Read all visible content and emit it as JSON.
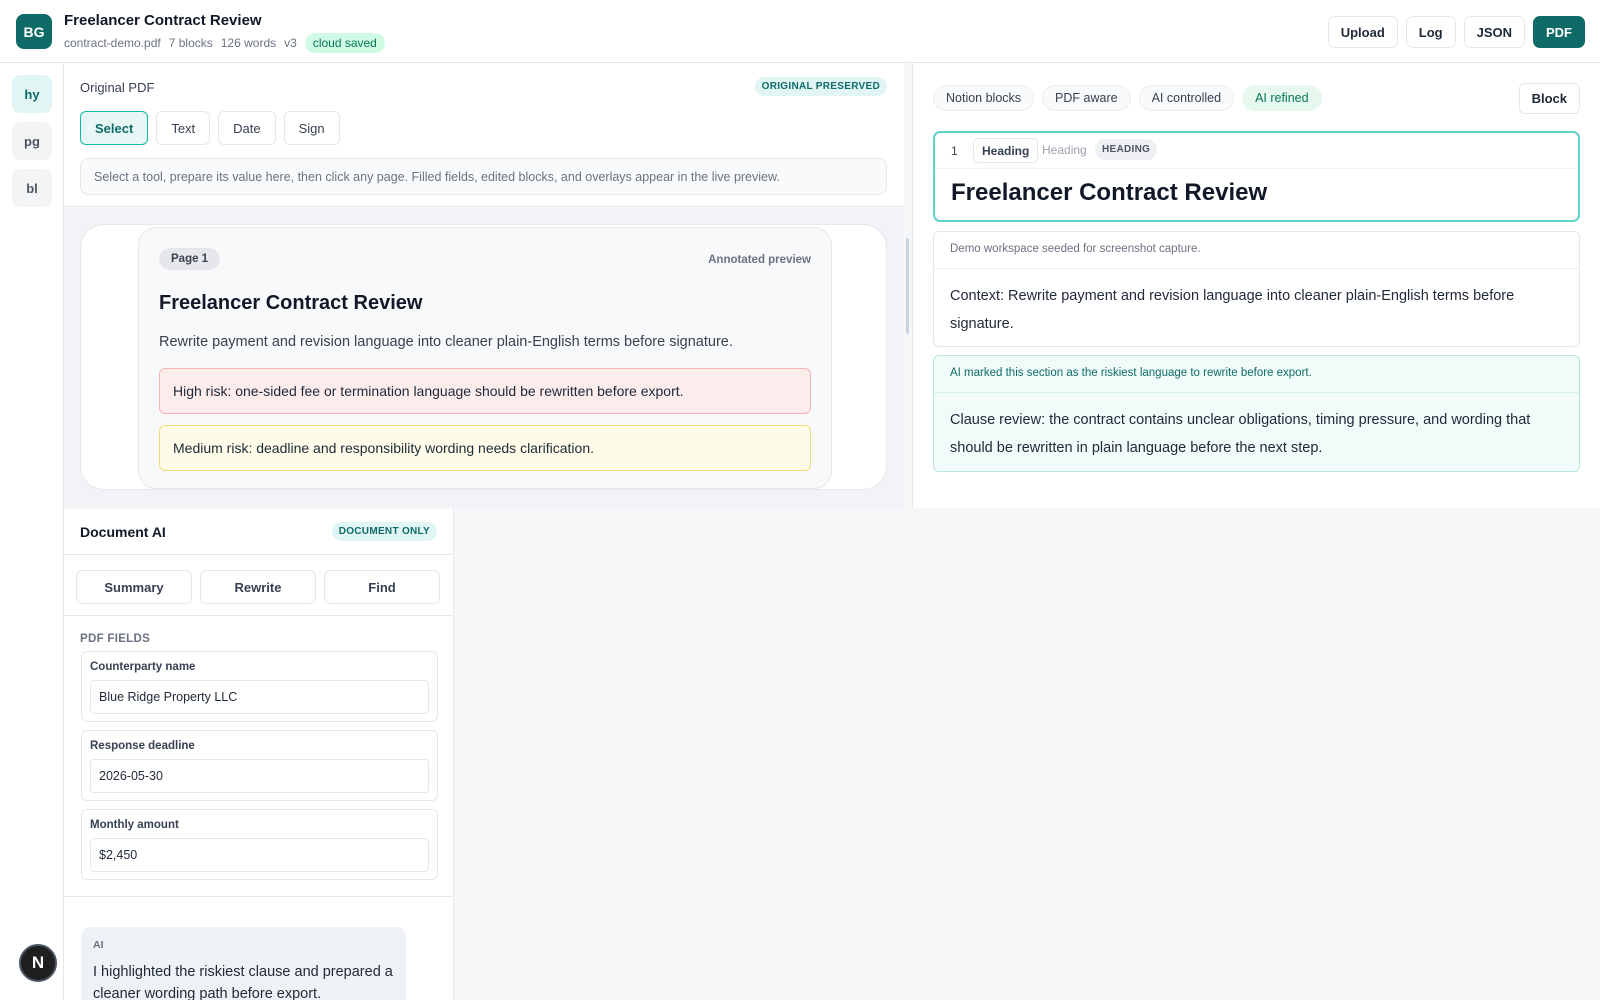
{
  "header": {
    "logo": "BG",
    "title": "Freelancer Contract Review",
    "file": "contract-demo.pdf",
    "blocks": "7 blocks",
    "words": "126 words",
    "version": "v3",
    "status": "cloud saved",
    "actions": {
      "upload": "Upload",
      "log": "Log",
      "json": "JSON",
      "pdf": "PDF"
    }
  },
  "rail": {
    "items": [
      {
        "label": "hy",
        "active": true
      },
      {
        "label": "pg",
        "active": false
      },
      {
        "label": "bl",
        "active": false
      }
    ],
    "bottom_badge": "N"
  },
  "original": {
    "title": "Original PDF",
    "badge": "ORIGINAL PRESERVED",
    "tools": [
      "Select",
      "Text",
      "Date",
      "Sign"
    ],
    "active_tool": "Select",
    "hint": "Select a tool, prepare its value here, then click any page. Filled fields, edited blocks, and overlays appear in the live preview.",
    "page": {
      "label": "Page 1",
      "mode": "Annotated preview",
      "heading": "Freelancer Contract Review",
      "paragraph": "Rewrite payment and revision language into cleaner plain-English terms before signature.",
      "high_risk": "High risk: one-sided fee or termination language should be rewritten before export.",
      "medium_risk": "Medium risk: deadline and responsibility wording needs clarification."
    }
  },
  "blocks_panel": {
    "chips": [
      "Notion blocks",
      "PDF aware",
      "AI controlled",
      "AI refined"
    ],
    "block_button": "Block",
    "block1": {
      "number": "1",
      "type_select": "Heading",
      "type_label": "Heading",
      "tag": "HEADING",
      "text": "Freelancer Contract Review"
    },
    "block2": {
      "note": "Demo workspace seeded for screenshot capture.",
      "text": "Context: Rewrite payment and revision language into cleaner plain-English terms before signature."
    },
    "block3": {
      "note": "AI marked this section as the riskiest language to rewrite before export.",
      "text": "Clause review: the contract contains unclear obligations, timing pressure, and wording that should be rewritten in plain language before the next step."
    }
  },
  "ai": {
    "title": "Document AI",
    "badge": "DOCUMENT ONLY",
    "tabs": [
      "Summary",
      "Rewrite",
      "Find"
    ],
    "fields_title": "PDF FIELDS",
    "fields": [
      {
        "label": "Counterparty name",
        "value": "Blue Ridge Property LLC"
      },
      {
        "label": "Response deadline",
        "value": "2026-05-30"
      },
      {
        "label": "Monthly amount",
        "value": "$2,450"
      }
    ],
    "message": {
      "who": "AI",
      "text": "I highlighted the riskiest clause and prepared a cleaner wording path before export."
    }
  },
  "colors": {
    "brand": "#0f6b68",
    "accent_border": "#5fd3c8",
    "high_risk_bg": "#fdecec",
    "medium_risk_bg": "#fefce8",
    "saved_green": "#047857"
  }
}
